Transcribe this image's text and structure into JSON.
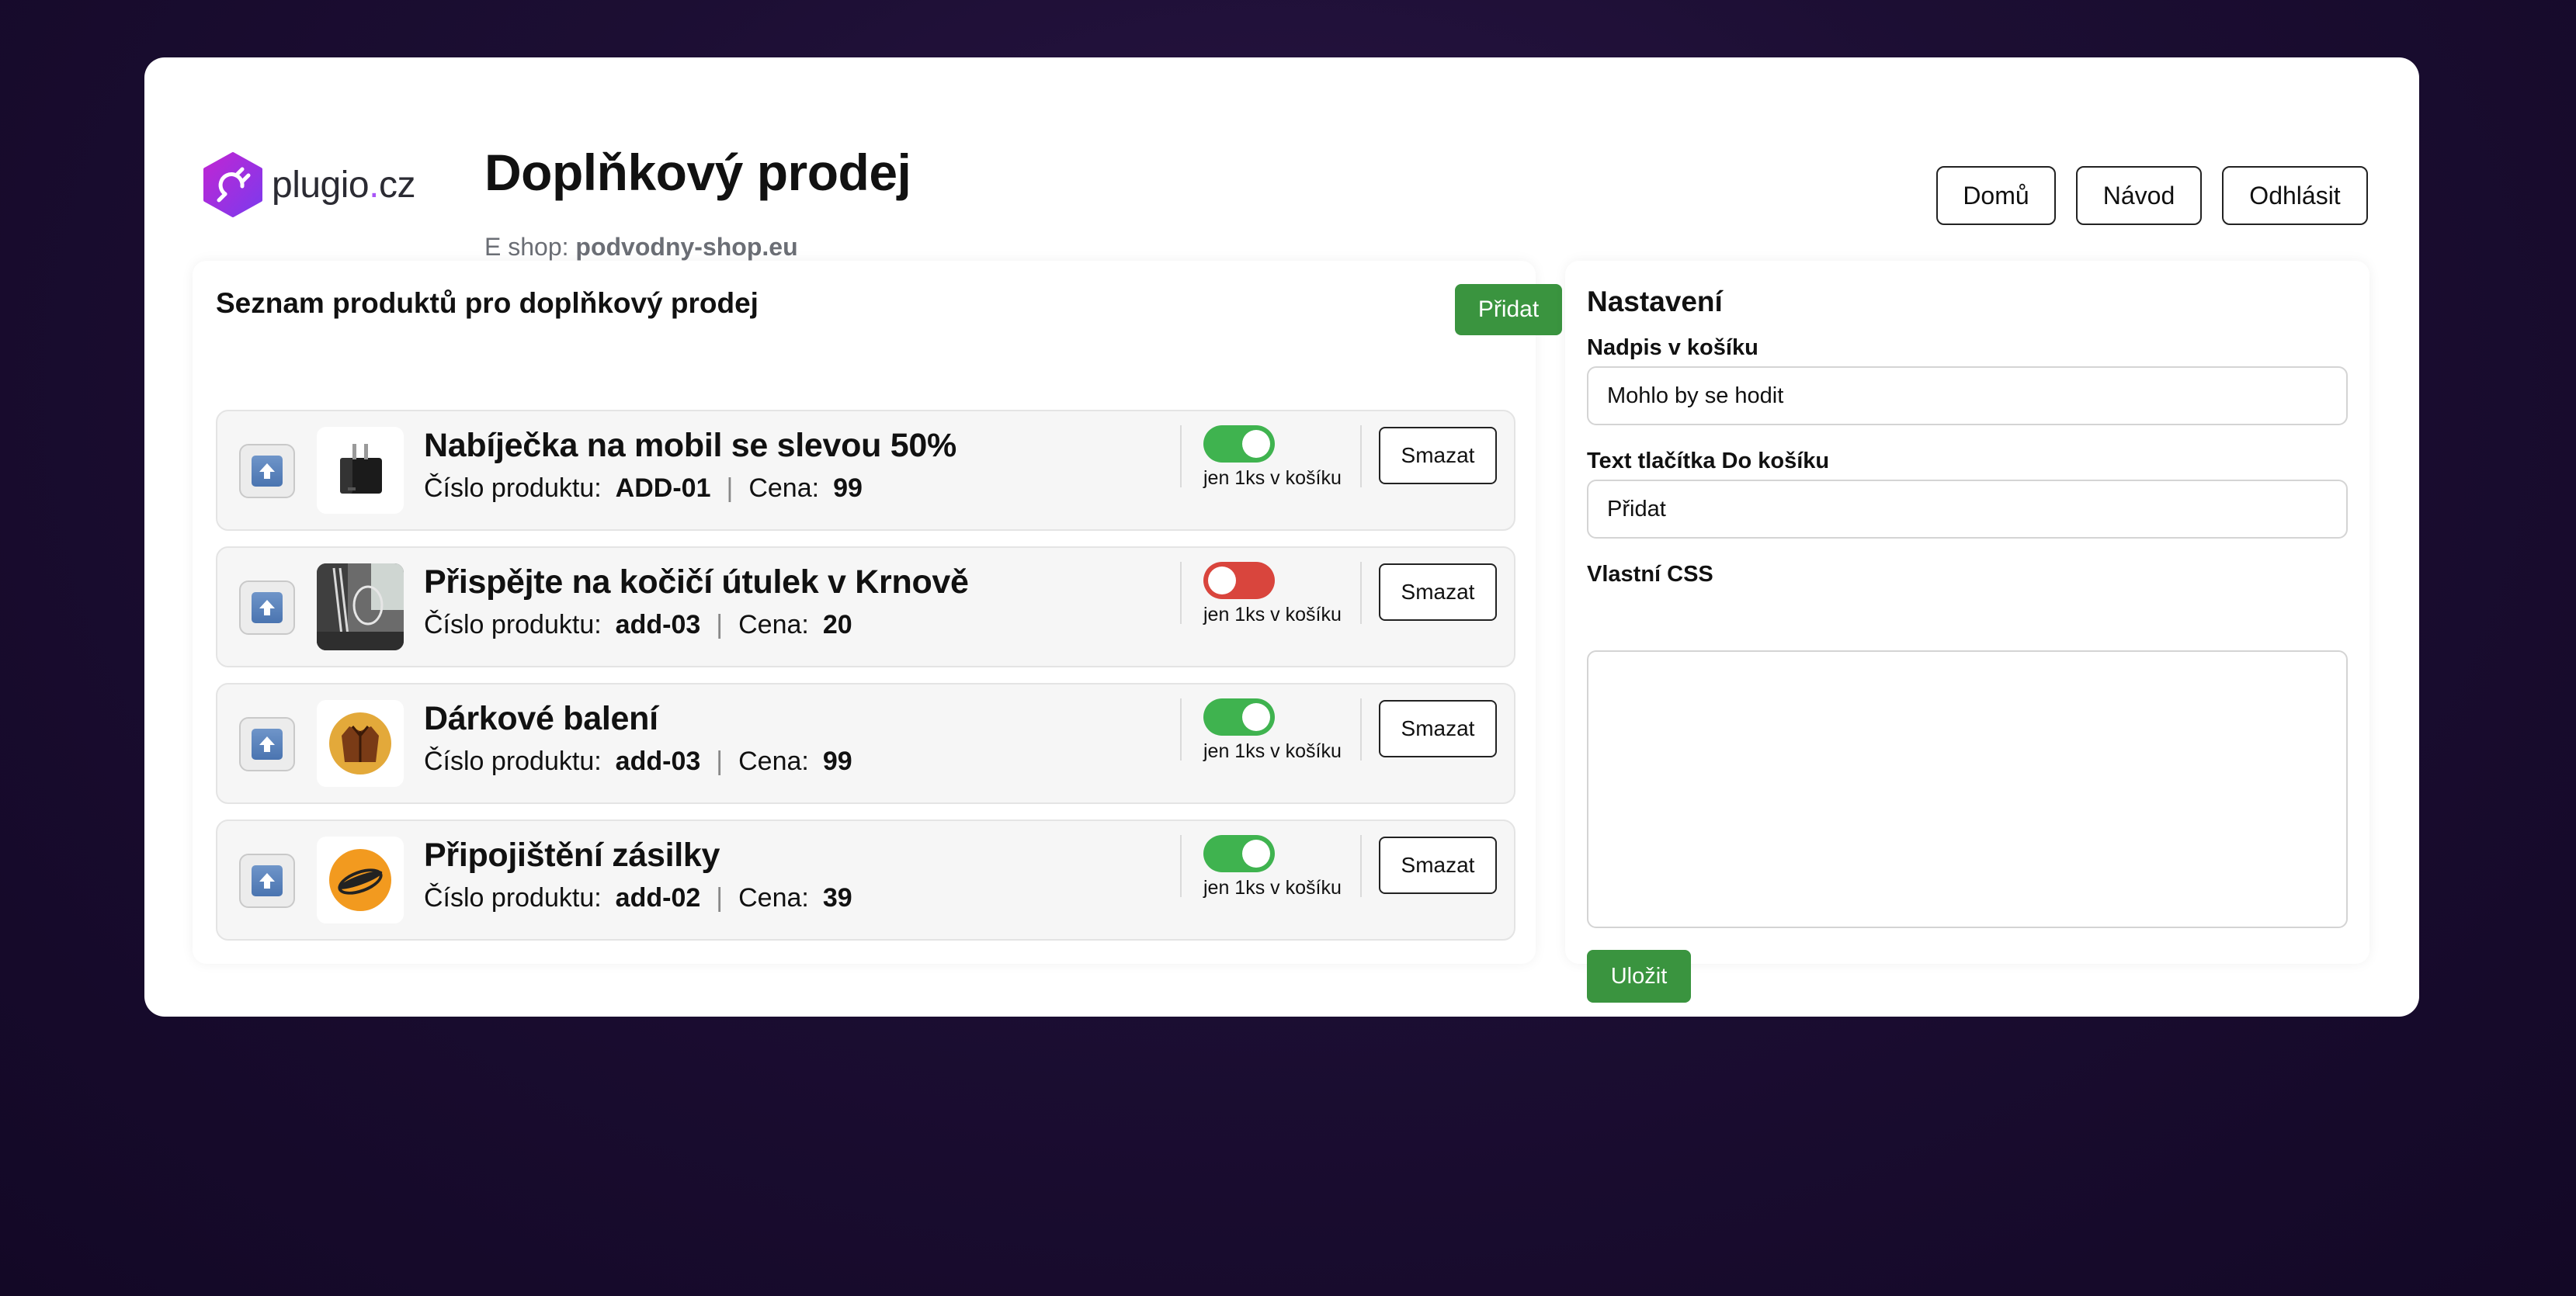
{
  "header": {
    "logo_text": "plugio",
    "logo_dot": ".",
    "logo_tld": "cz",
    "title": "Doplňkový prodej",
    "eshop_label": "E shop:",
    "eshop_name": "podvodny-shop.eu"
  },
  "nav": {
    "home": "Domů",
    "guide": "Návod",
    "logout": "Odhlásit"
  },
  "list": {
    "heading": "Seznam produktů pro doplňkový prodej",
    "add_label": "Přidat",
    "product_number_label": "Číslo produktu:",
    "price_label": "Cena:",
    "separator": "|",
    "toggle_label": "jen 1ks v košíku",
    "delete_label": "Smazat",
    "products": [
      {
        "name": "Nabíječka na mobil se slevou 50%",
        "code": "ADD-01",
        "price": "99",
        "single_only": true,
        "thumb_icon": "charger-icon"
      },
      {
        "name": "Přispějte na kočičí útulek v Krnově",
        "code": "add-03",
        "price": "20",
        "single_only": false,
        "thumb_icon": "shelter-photo"
      },
      {
        "name": "Dárkové balení",
        "code": "add-03",
        "price": "99",
        "single_only": true,
        "thumb_icon": "jacket-icon"
      },
      {
        "name": "Připojištění zásilky",
        "code": "add-02",
        "price": "39",
        "single_only": true,
        "thumb_icon": "hotdog-icon"
      }
    ]
  },
  "settings": {
    "heading": "Nastavení",
    "cart_heading_label": "Nadpis v košíku",
    "cart_heading_value": "Mohlo by se hodit",
    "button_text_label": "Text tlačítka Do košíku",
    "button_text_value": "Přidat",
    "css_label": "Vlastní CSS",
    "css_value": "",
    "save_label": "Uložit"
  },
  "colors": {
    "accent_green": "#3a943f",
    "toggle_on": "#3fb34f",
    "toggle_off": "#d9453d",
    "logo_purple": "#a855f7",
    "background": "#1c0e33"
  }
}
